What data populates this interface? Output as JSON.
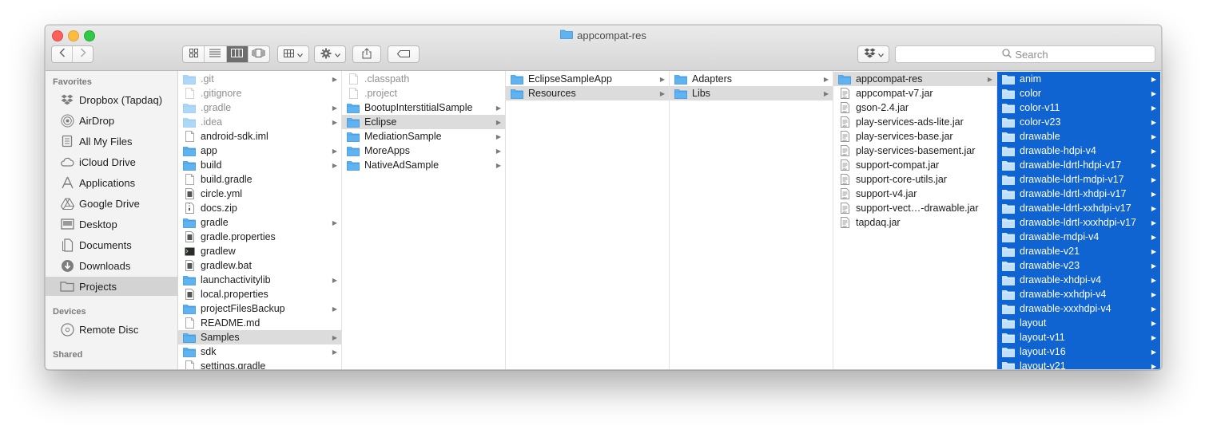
{
  "window": {
    "title": "appcompat-res"
  },
  "toolbar": {
    "search_placeholder": "Search"
  },
  "colors": {
    "selection_blue": "#0f64d2",
    "folder_blue": "#5fb3f0",
    "grey_selection": "#dcdcdc"
  },
  "sidebar": {
    "favorites_header": "Favorites",
    "devices_header": "Devices",
    "shared_header": "Shared",
    "favorites": [
      {
        "label": "Dropbox (Tapdaq)",
        "icon": "dropbox-icon"
      },
      {
        "label": "AirDrop",
        "icon": "airdrop-icon"
      },
      {
        "label": "All My Files",
        "icon": "all-files-icon"
      },
      {
        "label": "iCloud Drive",
        "icon": "cloud-icon"
      },
      {
        "label": "Applications",
        "icon": "applications-icon"
      },
      {
        "label": "Google Drive",
        "icon": "drive-icon"
      },
      {
        "label": "Desktop",
        "icon": "desktop-icon"
      },
      {
        "label": "Documents",
        "icon": "documents-icon"
      },
      {
        "label": "Downloads",
        "icon": "downloads-icon"
      },
      {
        "label": "Projects",
        "icon": "folder-icon",
        "selected": true
      }
    ],
    "devices": [
      {
        "label": "Remote Disc",
        "icon": "disc-icon"
      }
    ]
  },
  "columns": [
    [
      {
        "name": ".git",
        "type": "folder",
        "dim": true,
        "arrow": true
      },
      {
        "name": ".gitignore",
        "type": "file",
        "dim": true
      },
      {
        "name": ".gradle",
        "type": "folder",
        "dim": true,
        "arrow": true
      },
      {
        "name": ".idea",
        "type": "folder",
        "dim": true,
        "arrow": true
      },
      {
        "name": "android-sdk.iml",
        "type": "file"
      },
      {
        "name": "app",
        "type": "folder",
        "arrow": true
      },
      {
        "name": "build",
        "type": "folder",
        "arrow": true
      },
      {
        "name": "build.gradle",
        "type": "file"
      },
      {
        "name": "circle.yml",
        "type": "doc"
      },
      {
        "name": "docs.zip",
        "type": "zip"
      },
      {
        "name": "gradle",
        "type": "folder",
        "arrow": true
      },
      {
        "name": "gradle.properties",
        "type": "doc"
      },
      {
        "name": "gradlew",
        "type": "exec"
      },
      {
        "name": "gradlew.bat",
        "type": "doc"
      },
      {
        "name": "launchactivitylib",
        "type": "folder",
        "arrow": true
      },
      {
        "name": "local.properties",
        "type": "doc"
      },
      {
        "name": "projectFilesBackup",
        "type": "folder",
        "arrow": true
      },
      {
        "name": "README.md",
        "type": "file"
      },
      {
        "name": "Samples",
        "type": "folder",
        "arrow": true,
        "selected": "grey"
      },
      {
        "name": "sdk",
        "type": "folder",
        "arrow": true
      },
      {
        "name": "settings.gradle",
        "type": "file"
      }
    ],
    [
      {
        "name": ".classpath",
        "type": "file",
        "dim": true
      },
      {
        "name": ".project",
        "type": "file",
        "dim": true
      },
      {
        "name": "BootupInterstitialSample",
        "type": "folder",
        "arrow": true
      },
      {
        "name": "Eclipse",
        "type": "folder",
        "arrow": true,
        "selected": "grey"
      },
      {
        "name": "MediationSample",
        "type": "folder",
        "arrow": true
      },
      {
        "name": "MoreApps",
        "type": "folder",
        "arrow": true
      },
      {
        "name": "NativeAdSample",
        "type": "folder",
        "arrow": true
      }
    ],
    [
      {
        "name": "EclipseSampleApp",
        "type": "folder",
        "arrow": true
      },
      {
        "name": "Resources",
        "type": "folder",
        "arrow": true,
        "selected": "grey"
      }
    ],
    [
      {
        "name": "Adapters",
        "type": "folder",
        "arrow": true
      },
      {
        "name": "Libs",
        "type": "folder",
        "arrow": true,
        "selected": "grey"
      }
    ],
    [
      {
        "name": "appcompat-res",
        "type": "folder",
        "arrow": true,
        "selected": "grey"
      },
      {
        "name": "appcompat-v7.jar",
        "type": "jar"
      },
      {
        "name": "gson-2.4.jar",
        "type": "jar"
      },
      {
        "name": "play-services-ads-lite.jar",
        "type": "jar"
      },
      {
        "name": "play-services-base.jar",
        "type": "jar"
      },
      {
        "name": "play-services-basement.jar",
        "type": "jar"
      },
      {
        "name": "support-compat.jar",
        "type": "jar"
      },
      {
        "name": "support-core-utils.jar",
        "type": "jar"
      },
      {
        "name": "support-v4.jar",
        "type": "jar"
      },
      {
        "name": "support-vect…-drawable.jar",
        "type": "jar"
      },
      {
        "name": "tapdaq.jar",
        "type": "jar"
      }
    ],
    [
      {
        "name": "anim",
        "type": "folder",
        "arrow": true,
        "selected": "blue"
      },
      {
        "name": "color",
        "type": "folder",
        "arrow": true,
        "selected": "blue"
      },
      {
        "name": "color-v11",
        "type": "folder",
        "arrow": true,
        "selected": "blue"
      },
      {
        "name": "color-v23",
        "type": "folder",
        "arrow": true,
        "selected": "blue"
      },
      {
        "name": "drawable",
        "type": "folder",
        "arrow": true,
        "selected": "blue"
      },
      {
        "name": "drawable-hdpi-v4",
        "type": "folder",
        "arrow": true,
        "selected": "blue"
      },
      {
        "name": "drawable-ldrtl-hdpi-v17",
        "type": "folder",
        "arrow": true,
        "selected": "blue"
      },
      {
        "name": "drawable-ldrtl-mdpi-v17",
        "type": "folder",
        "arrow": true,
        "selected": "blue"
      },
      {
        "name": "drawable-ldrtl-xhdpi-v17",
        "type": "folder",
        "arrow": true,
        "selected": "blue"
      },
      {
        "name": "drawable-ldrtl-xxhdpi-v17",
        "type": "folder",
        "arrow": true,
        "selected": "blue"
      },
      {
        "name": "drawable-ldrtl-xxxhdpi-v17",
        "type": "folder",
        "arrow": true,
        "selected": "blue"
      },
      {
        "name": "drawable-mdpi-v4",
        "type": "folder",
        "arrow": true,
        "selected": "blue"
      },
      {
        "name": "drawable-v21",
        "type": "folder",
        "arrow": true,
        "selected": "blue"
      },
      {
        "name": "drawable-v23",
        "type": "folder",
        "arrow": true,
        "selected": "blue"
      },
      {
        "name": "drawable-xhdpi-v4",
        "type": "folder",
        "arrow": true,
        "selected": "blue"
      },
      {
        "name": "drawable-xxhdpi-v4",
        "type": "folder",
        "arrow": true,
        "selected": "blue"
      },
      {
        "name": "drawable-xxxhdpi-v4",
        "type": "folder",
        "arrow": true,
        "selected": "blue"
      },
      {
        "name": "layout",
        "type": "folder",
        "arrow": true,
        "selected": "blue"
      },
      {
        "name": "layout-v11",
        "type": "folder",
        "arrow": true,
        "selected": "blue"
      },
      {
        "name": "layout-v16",
        "type": "folder",
        "arrow": true,
        "selected": "blue"
      },
      {
        "name": "layout-v21",
        "type": "folder",
        "arrow": true,
        "selected": "blue"
      }
    ]
  ]
}
